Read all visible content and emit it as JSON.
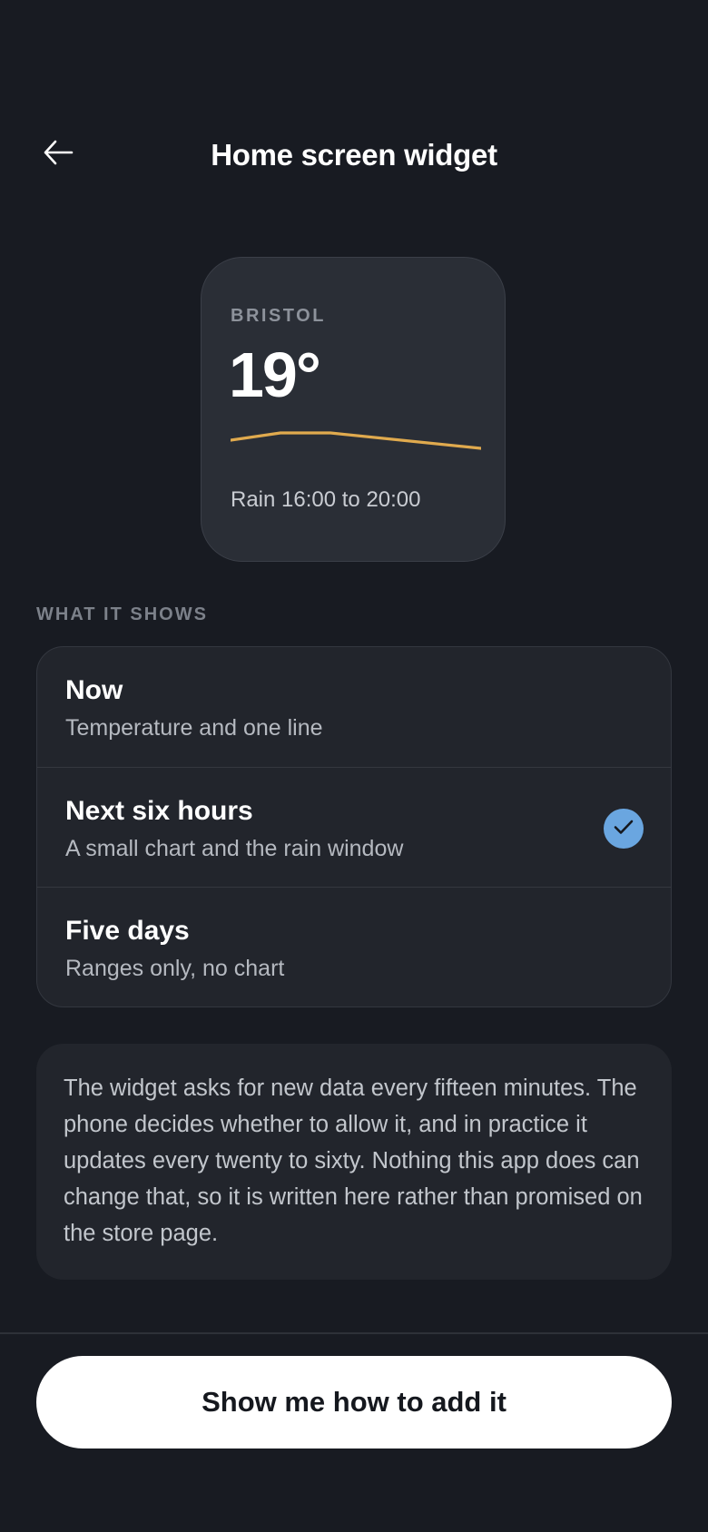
{
  "header": {
    "title": "Home screen widget",
    "back_icon": "arrow-left-icon"
  },
  "widget": {
    "city": "BRISTOL",
    "temperature": "19°",
    "rain_text": "Rain 16:00 to 20:00",
    "line_color": "#e0aa4e"
  },
  "section": {
    "label": "WHAT IT SHOWS"
  },
  "options": [
    {
      "title": "Now",
      "description": "Temperature and one line",
      "selected": false
    },
    {
      "title": "Next six hours",
      "description": "A small chart and the rain window",
      "selected": true
    },
    {
      "title": "Five days",
      "description": "Ranges only, no chart",
      "selected": false
    }
  ],
  "note": {
    "text": "The widget asks for new data every fifteen minutes. The phone decides whether to allow it, and in practice it updates every twenty to sixty. Nothing this app does can change that, so it is written here rather than promised on the store page."
  },
  "cta": {
    "label": "Show me how to add it"
  },
  "colors": {
    "background": "#181b22",
    "accent": "#6aa6e0",
    "card": "#22252c"
  }
}
